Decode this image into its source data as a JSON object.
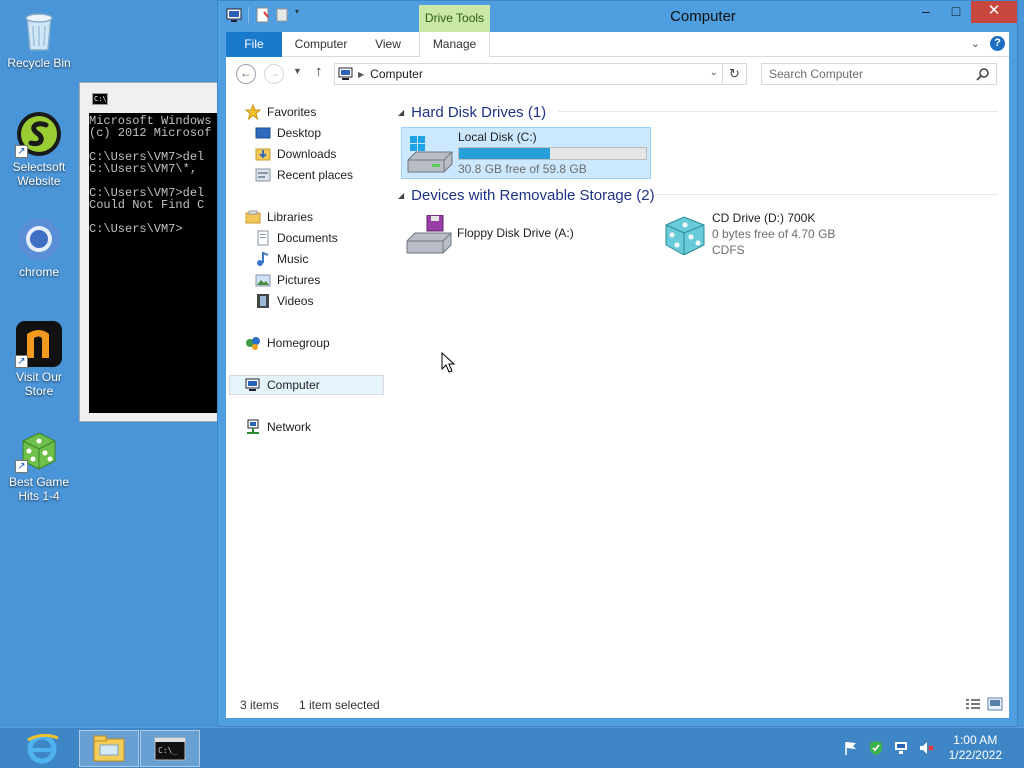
{
  "desktop": {
    "icons": [
      {
        "label": "Recycle Bin"
      },
      {
        "label": "Selectsoft Website"
      },
      {
        "label": "chrome"
      },
      {
        "label": "Visit Our Store"
      },
      {
        "label": "Best Game Hits 1-4"
      }
    ]
  },
  "cmd": {
    "icon_text": "C:\\_",
    "lines": "Microsoft Windows\n(c) 2012 Microsof\n\nC:\\Users\\VM7>del\nC:\\Users\\VM7\\*, \n\nC:\\Users\\VM7>del\nCould Not Find C\n\nC:\\Users\\VM7>"
  },
  "explorer": {
    "title": "Computer",
    "contextual_tab": "Drive Tools",
    "ribbon_tabs": [
      "File",
      "Computer",
      "View",
      "Manage"
    ],
    "window_buttons": {
      "minimize": "–",
      "maximize": "□",
      "close": "✕"
    },
    "address": {
      "crumb": "Computer"
    },
    "search": {
      "placeholder": "Search Computer"
    },
    "nav": {
      "favorites": "Favorites",
      "desktop": "Desktop",
      "downloads": "Downloads",
      "recent": "Recent places",
      "libraries": "Libraries",
      "documents": "Documents",
      "music": "Music",
      "pictures": "Pictures",
      "videos": "Videos",
      "homegroup": "Homegroup",
      "computer": "Computer",
      "network": "Network"
    },
    "groups": {
      "hdd": "Hard Disk Drives (1)",
      "removable": "Devices with Removable Storage (2)"
    },
    "drives": {
      "c": {
        "name": "Local Disk (C:)",
        "free": "30.8 GB free of 59.8 GB",
        "used_fraction": 0.485
      },
      "a": {
        "name": "Floppy Disk Drive (A:)"
      },
      "d": {
        "name": "CD Drive (D:) 700K",
        "free": "0 bytes free of 4.70 GB",
        "fs": "CDFS"
      }
    },
    "status": {
      "items": "3 items",
      "selected": "1 item selected"
    }
  },
  "taskbar": {
    "time": "1:00 AM",
    "date": "1/22/2022"
  }
}
